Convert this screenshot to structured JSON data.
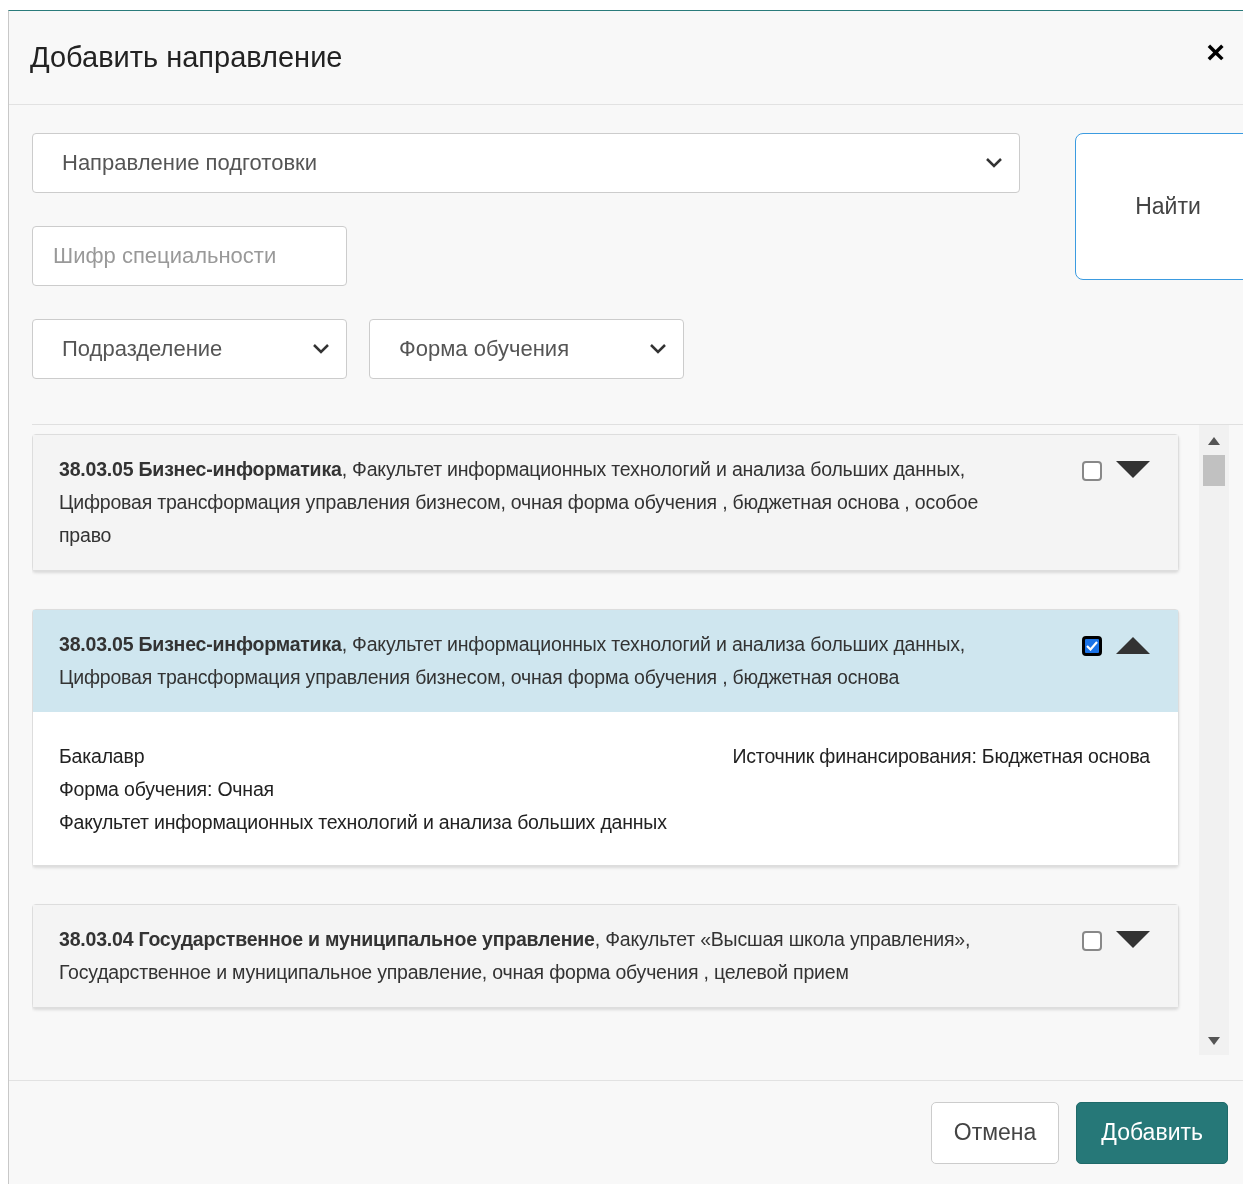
{
  "dialog": {
    "title": "Добавить направление",
    "close": "×"
  },
  "filters": {
    "direction": {
      "placeholder": "Направление подготовки"
    },
    "code": {
      "placeholder": "Шифр специальности"
    },
    "department": {
      "placeholder": "Подразделение"
    },
    "form": {
      "placeholder": "Форма обучения"
    },
    "find_button": "Найти"
  },
  "results": [
    {
      "text": "**38.03.05 Бизнес-информатика**, Факультет информационных технологий и анализа больших данных, Цифровая трансформация управления бизнесом, очная форма обучения , бюджетная основа , особое право",
      "checked": false,
      "expanded": false
    },
    {
      "text": "**38.03.05 Бизнес-информатика**, Факультет информационных технологий и анализа больших данных, Цифровая трансформация управления бизнесом, очная форма обучения , бюджетная основа",
      "checked": true,
      "expanded": true,
      "details": {
        "left": [
          "Бакалавр",
          "Форма обучения: Очная",
          "Факультет информационных технологий и анализа больших данных"
        ],
        "right": "Источник финансирования: Бюджетная основа"
      }
    },
    {
      "text": "**38.03.04 Государственное и муниципальное управление**, Факультет «Высшая школа управления», Государственное и муниципальное управление, очная форма обучения , целевой прием",
      "checked": false,
      "expanded": false
    }
  ],
  "buttons": {
    "cancel": "Отмена",
    "add": "Добавить"
  }
}
